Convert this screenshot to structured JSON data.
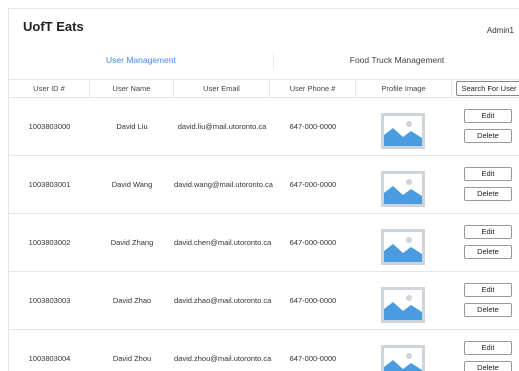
{
  "header": {
    "title": "UofT Eats",
    "user": "Admin1"
  },
  "tabs": [
    {
      "label": "User Management",
      "active": true
    },
    {
      "label": "Food Truck Management",
      "active": false
    }
  ],
  "table": {
    "columns": [
      "User ID #",
      "User Name",
      "User Email",
      "User Phone #",
      "Profile Image"
    ],
    "search_label": "Search For User",
    "edit_label": "Edit",
    "delete_label": "Delete",
    "image_icon": "image-placeholder-icon",
    "rows": [
      {
        "id": "1003803000",
        "name": "David Liu",
        "email": "david.liu@mail.utoronto.ca",
        "phone": "647-000-0000"
      },
      {
        "id": "1003803001",
        "name": "David Wang",
        "email": "david.wang@mail.utoronto.ca",
        "phone": "647-000-0000"
      },
      {
        "id": "1003803002",
        "name": "David Zhang",
        "email": "david.chen@mail.utoronto.ca",
        "phone": "647-000-0000"
      },
      {
        "id": "1003803003",
        "name": "David Zhao",
        "email": "david.zhao@mail.utoronto.ca",
        "phone": "647-000-0000"
      },
      {
        "id": "1003803004",
        "name": "David Zhou",
        "email": "david.zhou@mail.utoronto.ca",
        "phone": "647-000-0000"
      }
    ]
  },
  "colors": {
    "accent": "#3a8ee6",
    "image_sky": "#4a9be0",
    "image_frame": "#cfd4da"
  }
}
